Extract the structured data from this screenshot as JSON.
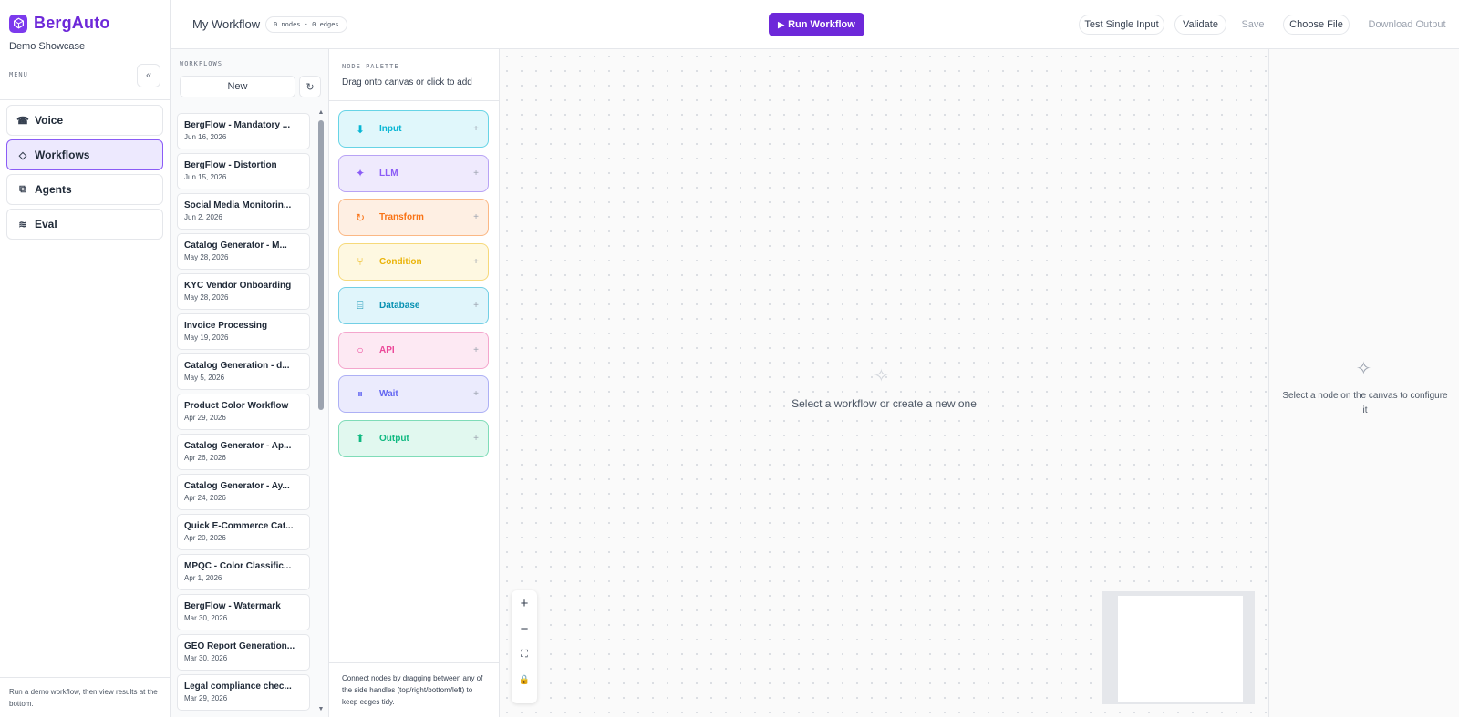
{
  "sidebar": {
    "brand_name": "BergAuto",
    "brand_sub": "Demo Showcase",
    "menu_label": "MENU",
    "collapse_icon": "«",
    "items": [
      {
        "label": "Voice",
        "icon": "☎"
      },
      {
        "label": "Workflows",
        "icon": "◇"
      },
      {
        "label": "Agents",
        "icon": "⧉"
      },
      {
        "label": "Eval",
        "icon": "≋"
      }
    ],
    "footer": "Run a demo workflow, then view results at the bottom."
  },
  "topbar": {
    "workflow_title": "My Workflow",
    "counts": "0 nodes · 0 edges",
    "run_label": "Run Workflow",
    "run_icon": "▶",
    "test_label": "Test Single Input",
    "validate_label": "Validate",
    "save_label": "Save",
    "choose_file_label": "Choose File",
    "download_label": "Download Output"
  },
  "workflows": {
    "label": "WORKFLOWS",
    "new_label": "New",
    "refresh_icon": "↻",
    "scroll_up": "▲",
    "scroll_down": "▼",
    "items": [
      {
        "title": "BergFlow - Mandatory ...",
        "date": "Jun 16, 2026"
      },
      {
        "title": "BergFlow - Distortion",
        "date": "Jun 15, 2026"
      },
      {
        "title": "Social Media Monitorin...",
        "date": "Jun 2, 2026"
      },
      {
        "title": "Catalog Generator - M...",
        "date": "May 28, 2026"
      },
      {
        "title": "KYC Vendor Onboarding",
        "date": "May 28, 2026"
      },
      {
        "title": "Invoice Processing",
        "date": "May 19, 2026"
      },
      {
        "title": "Catalog Generation - d...",
        "date": "May 5, 2026"
      },
      {
        "title": "Product Color Workflow",
        "date": "Apr 29, 2026"
      },
      {
        "title": "Catalog Generator - Ap...",
        "date": "Apr 26, 2026"
      },
      {
        "title": "Catalog Generator - Ay...",
        "date": "Apr 24, 2026"
      },
      {
        "title": "Quick E-Commerce Cat...",
        "date": "Apr 20, 2026"
      },
      {
        "title": "MPQC - Color Classific...",
        "date": "Apr 1, 2026"
      },
      {
        "title": "BergFlow - Watermark",
        "date": "Mar 30, 2026"
      },
      {
        "title": "GEO Report Generation...",
        "date": "Mar 30, 2026"
      },
      {
        "title": "Legal compliance chec...",
        "date": "Mar 29, 2026"
      }
    ]
  },
  "palette": {
    "label": "NODE PALETTE",
    "subtitle": "Drag onto canvas or click to add",
    "plus": "+",
    "nodes": [
      {
        "label": "Input",
        "icon": "⬇",
        "color": "#06b6d4",
        "bg": "#e0f7fb",
        "border": "#67d4e6"
      },
      {
        "label": "LLM",
        "icon": "✦",
        "color": "#8b5cf6",
        "bg": "#efeafd",
        "border": "#b8a3f5"
      },
      {
        "label": "Transform",
        "icon": "↻",
        "color": "#f97316",
        "bg": "#feefe3",
        "border": "#fbb885"
      },
      {
        "label": "Condition",
        "icon": "⑂",
        "color": "#eab308",
        "bg": "#fef8e1",
        "border": "#f6d97a"
      },
      {
        "label": "Database",
        "icon": "⌸",
        "color": "#0891b2",
        "bg": "#e0f5fb",
        "border": "#72cfe5"
      },
      {
        "label": "API",
        "icon": "○",
        "color": "#ec4899",
        "bg": "#fde9f3",
        "border": "#f4a6cd"
      },
      {
        "label": "Wait",
        "icon": "⏸",
        "color": "#6366f1",
        "bg": "#ebebfd",
        "border": "#adb0f5"
      },
      {
        "label": "Output",
        "icon": "⬆",
        "color": "#10b981",
        "bg": "#e1f8ef",
        "border": "#7fdcb8"
      }
    ],
    "footer": "Connect nodes by dragging between any of the side handles (top/right/bottom/left) to keep edges tidy."
  },
  "canvas": {
    "empty_icon": "✧",
    "empty_text": "Select a workflow or create a new one",
    "zoom_in": "+",
    "zoom_out": "−",
    "fit": "⛶",
    "lock": "🔒"
  },
  "config": {
    "icon": "✧",
    "text": "Select a node on the canvas to configure it"
  }
}
